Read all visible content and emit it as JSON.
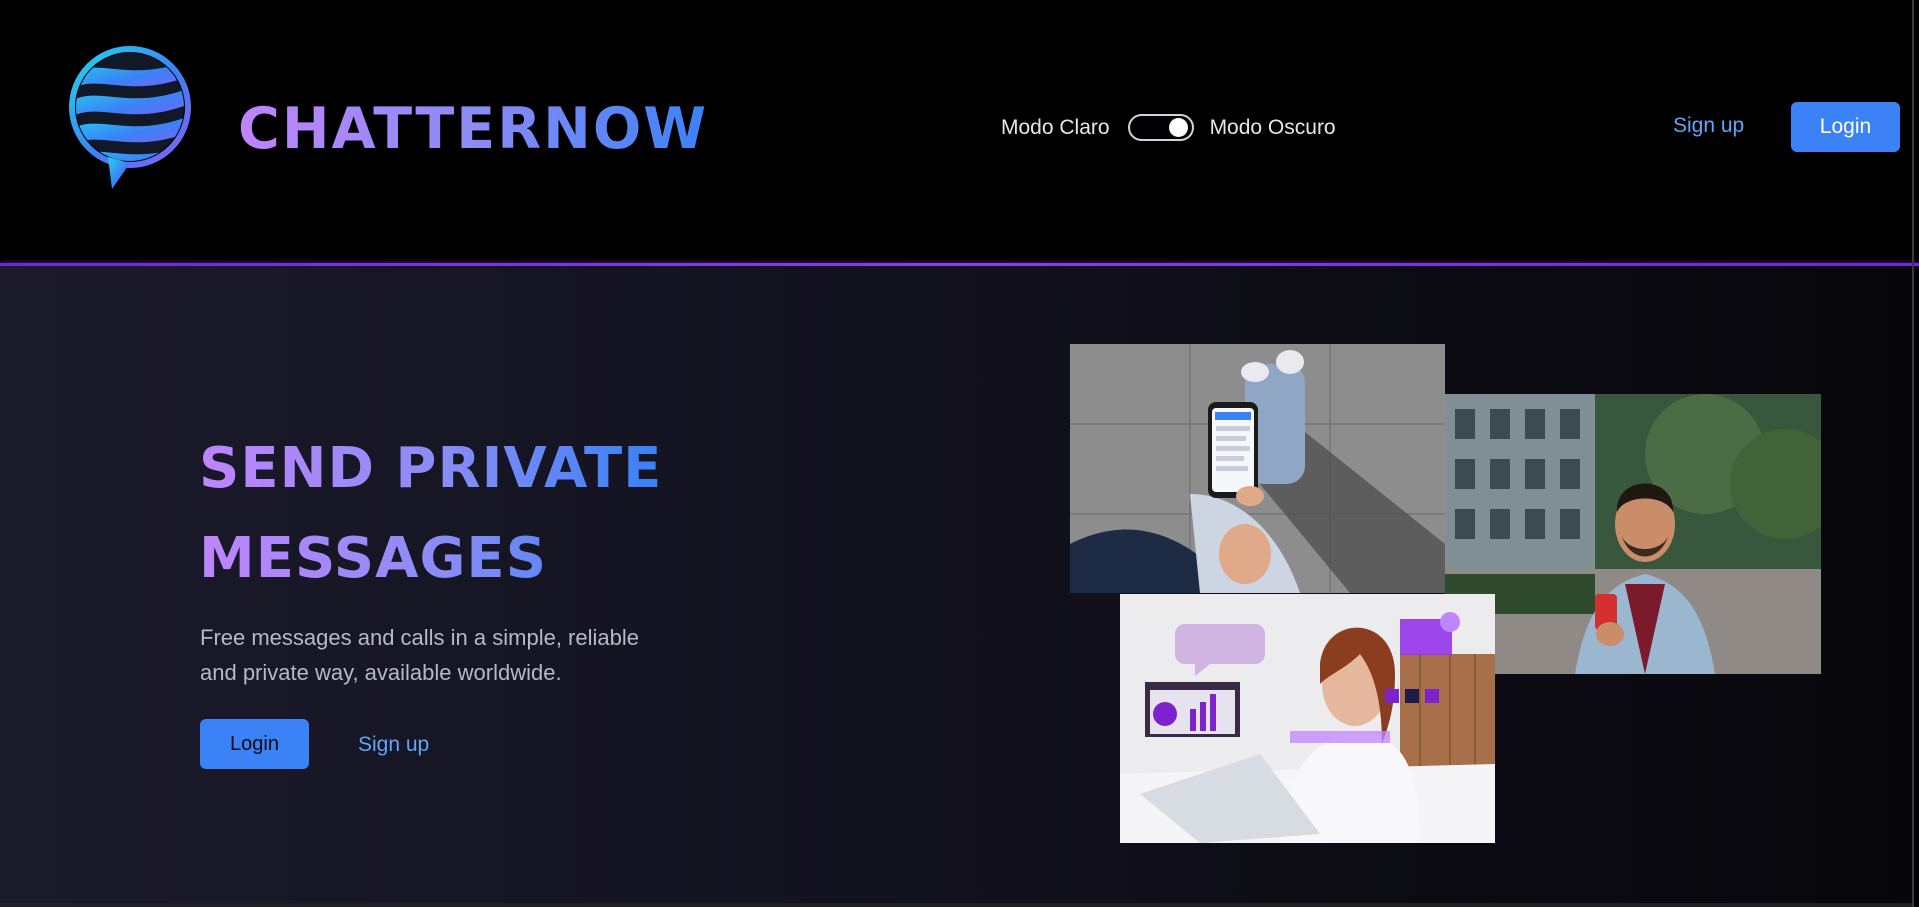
{
  "header": {
    "brand": "CHATTERNOW",
    "logo_icon": "speech-bubble-globe-icon",
    "theme_light_label": "Modo Claro",
    "theme_dark_label": "Modo Oscuro",
    "theme_toggle_state": "dark",
    "signup_label": "Sign up",
    "login_label": "Login"
  },
  "hero": {
    "title_line1": "SEND PRIVATE",
    "title_line2": "MESSAGES",
    "description": "Free messages and calls in a simple, reliable and private way, available worldwide.",
    "login_label": "Login",
    "signup_label": "Sign up"
  },
  "colors": {
    "accent_blue": "#3b82f6",
    "link_blue": "#60a5fa",
    "gradient_purple": "#c084fc",
    "divider_purple": "#8b3fe6",
    "header_bg": "#000000",
    "hero_bg": "#13121f"
  }
}
